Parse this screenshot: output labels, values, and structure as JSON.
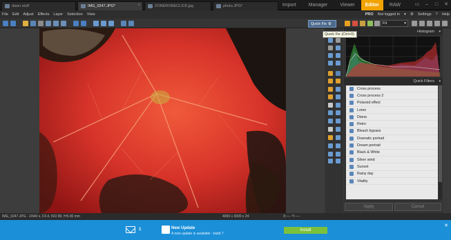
{
  "tabs": [
    {
      "label": "dawn stuff"
    },
    {
      "label": "IMG_0247.JPG*"
    },
    {
      "label": "ZONERONECLICK.jpg"
    },
    {
      "label": "photo.JPG*"
    }
  ],
  "modes": [
    "Import",
    "Manager",
    "Viewer",
    "Editor",
    "RAW"
  ],
  "active_mode": "Editor",
  "menu": [
    "File",
    "Edit",
    "Adjust",
    "Effects",
    "Layer",
    "Selection",
    "View"
  ],
  "menu_right": {
    "pro": "PRO",
    "login": "Not logged in",
    "settings": "Settings",
    "help": "Help"
  },
  "toolbar": {
    "quick_fix": "Quick Fix",
    "tooltip": "Quick Fix (Ctrl+0)",
    "zoom_select": "Fit"
  },
  "panel": {
    "histogram_title": "Histogram",
    "quick_filters_title": "Quick Filters",
    "filters": [
      "Cross process",
      "Cross process 2",
      "Polaroid effect",
      "Lomo",
      "Diana",
      "Retro",
      "Bleach bypass",
      "Dramatic portrait",
      "Dream portrait",
      "Black & White",
      "Silver wind",
      "Sunset",
      "Rainy day",
      "Vitality"
    ],
    "apply": "Apply",
    "cancel": "Cancel"
  },
  "status": {
    "file_info": "IMG_0247.JPG - 1/640 s, F3.4, ISO 80, f=5.00 mm",
    "dims": "4000 x 3000 x 24",
    "coords": "X:---- Y:----"
  },
  "notification": {
    "count": "1",
    "title": "New Update",
    "message": "A new update is available - build 7",
    "install": "Install"
  },
  "colors": {
    "accent": "#f2a300",
    "notif_bg": "#1b8fd8",
    "install": "#7cc13b"
  }
}
